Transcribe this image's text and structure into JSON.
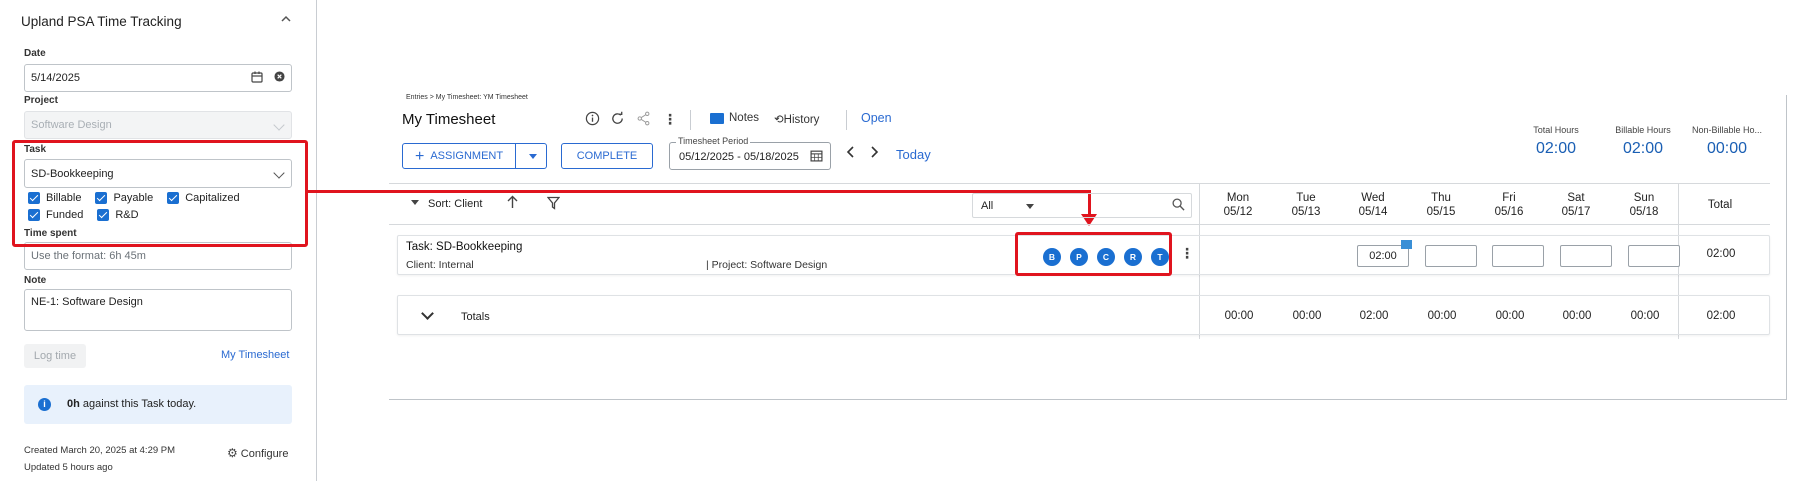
{
  "panel": {
    "title": "Upland PSA Time Tracking",
    "date_label": "Date",
    "date_value": "5/14/2025",
    "project_label": "Project",
    "project_value": "Software Design",
    "task_label": "Task",
    "task_value": "SD-Bookkeeping",
    "checkboxes": [
      {
        "label": "Billable",
        "checked": true
      },
      {
        "label": "Payable",
        "checked": true
      },
      {
        "label": "Capitalized",
        "checked": true
      },
      {
        "label": "Funded",
        "checked": true
      },
      {
        "label": "R&D",
        "checked": true
      }
    ],
    "time_spent_label": "Time spent",
    "time_spent_placeholder": "Use the format: 6h 45m",
    "note_label": "Note",
    "note_value": "NE-1: Software Design",
    "log_time_label": "Log time",
    "my_timesheet_link": "My Timesheet",
    "info_bold": "0h",
    "info_text": " against this Task today.",
    "created": "Created March 20, 2025 at 4:29 PM",
    "updated": "Updated 5 hours ago",
    "configure_label": "Configure"
  },
  "timesheet": {
    "breadcrumb": "Entries > My Timesheet: YM Timesheet",
    "title": "My Timesheet",
    "notes_label": "Notes",
    "history_label": "History",
    "status": "Open",
    "assignment_label": "ASSIGNMENT",
    "complete_label": "COMPLETE",
    "period_legend": "Timesheet Period",
    "period_value": "05/12/2025 - 05/18/2025",
    "today_label": "Today",
    "summary": [
      {
        "label": "Total Hours",
        "value": "02:00"
      },
      {
        "label": "Billable Hours",
        "value": "02:00"
      },
      {
        "label": "Non-Billable Ho...",
        "value": "00:00"
      }
    ],
    "sort_label": "Sort: Client",
    "filter_value": "All",
    "days": [
      {
        "name": "Mon",
        "date": "05/12"
      },
      {
        "name": "Tue",
        "date": "05/13"
      },
      {
        "name": "Wed",
        "date": "05/14"
      },
      {
        "name": "Thu",
        "date": "05/15"
      },
      {
        "name": "Fri",
        "date": "05/16"
      },
      {
        "name": "Sat",
        "date": "05/17"
      },
      {
        "name": "Sun",
        "date": "05/18"
      }
    ],
    "total_label": "Total",
    "task_row": {
      "name": "Task: SD-Bookkeeping",
      "client": "Client: Internal",
      "project": "| Project: Software Design",
      "flags": [
        "B",
        "P",
        "C",
        "R",
        "T"
      ],
      "entries": [
        "",
        "",
        "02:00",
        "",
        "",
        "",
        ""
      ],
      "total": "02:00"
    },
    "totals_row": {
      "label": "Totals",
      "values": [
        "00:00",
        "00:00",
        "02:00",
        "00:00",
        "00:00",
        "00:00",
        "00:00"
      ],
      "total": "02:00"
    }
  },
  "colors": {
    "accent": "#1a6fd1",
    "link": "#2a6ad1",
    "highlight": "#e0141e",
    "summary_value": "#1a5fb4"
  }
}
